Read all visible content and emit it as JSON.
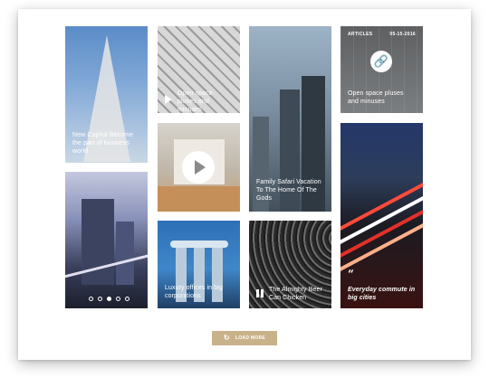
{
  "tiles": {
    "tall_tower": {
      "caption": "New Capital Become the part of business world"
    },
    "dome": {
      "caption": "Open space pluses and minuses"
    },
    "skyscrapers": {
      "caption": "Family Safari Vacation To The Home Of The Gods"
    },
    "article": {
      "label": "ARTICLES",
      "date": "05-15-2016",
      "caption": "Open space pluses and minuses",
      "icon": "link-icon"
    },
    "interior_video": {
      "icon": "play-icon"
    },
    "traffic": {
      "caption": "Everyday commute in big cities",
      "icon": "quote-icon"
    },
    "city_slider": {
      "slides": 5,
      "active_slide": 3
    },
    "marina": {
      "caption": "Luxury offices in big corporations"
    },
    "abstract": {
      "caption": "The Almighty Beer Can Chicken",
      "icon": "pause-icon"
    }
  },
  "load_more": {
    "label": "LOAD MORE",
    "icon": "refresh-icon"
  }
}
